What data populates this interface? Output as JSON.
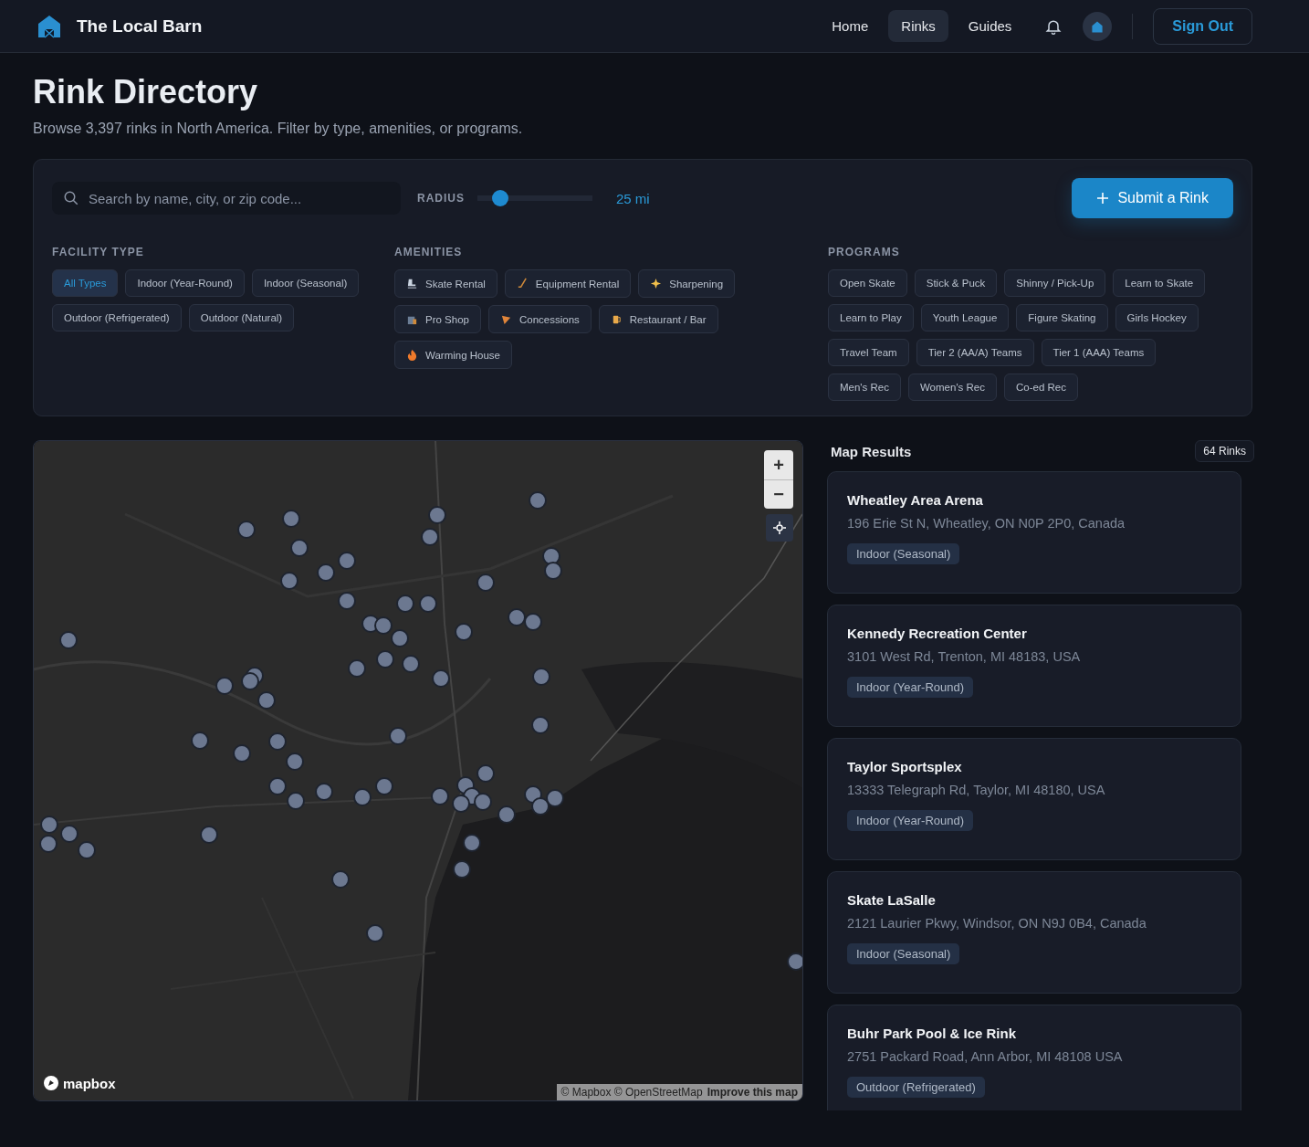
{
  "nav": {
    "brand": "The Local Barn",
    "links": [
      {
        "label": "Home",
        "selected": false
      },
      {
        "label": "Rinks",
        "selected": true
      },
      {
        "label": "Guides",
        "selected": false
      }
    ],
    "sign_out": "Sign Out"
  },
  "page": {
    "title": "Rink Directory",
    "subtitle": "Browse 3,397 rinks in North America. Filter by type, amenities, or programs."
  },
  "filters": {
    "search": {
      "placeholder": "Search by name, city, or zip code..."
    },
    "radius": {
      "label": "RADIUS",
      "level": 0.2,
      "reading": "25 mi"
    },
    "submit": "Submit a Rink",
    "facility_type": {
      "title": "FACILITY TYPE",
      "options": [
        {
          "label": "All Types",
          "selected": true
        },
        {
          "label": "Indoor (Year-Round)",
          "selected": false
        },
        {
          "label": "Indoor (Seasonal)",
          "selected": false
        },
        {
          "label": "Outdoor (Refrigerated)",
          "selected": false
        },
        {
          "label": "Outdoor (Natural)",
          "selected": false
        }
      ]
    },
    "amenities": {
      "title": "AMENITIES",
      "options": [
        {
          "label": "Skate Rental",
          "selected": false
        },
        {
          "label": "Equipment Rental",
          "selected": false
        },
        {
          "label": "Sharpening",
          "selected": false
        },
        {
          "label": "Pro Shop",
          "selected": false
        },
        {
          "label": "Concessions",
          "selected": false
        },
        {
          "label": "Restaurant / Bar",
          "selected": false
        },
        {
          "label": "Warming House",
          "selected": false
        }
      ]
    },
    "programs": {
      "title": "PROGRAMS",
      "options": [
        {
          "label": "Open Skate",
          "selected": false
        },
        {
          "label": "Stick & Puck",
          "selected": false
        },
        {
          "label": "Shinny / Pick-Up",
          "selected": false
        },
        {
          "label": "Learn to Skate",
          "selected": false
        },
        {
          "label": "Learn to Play",
          "selected": false
        },
        {
          "label": "Youth League",
          "selected": false
        },
        {
          "label": "Figure Skating",
          "selected": false
        },
        {
          "label": "Girls Hockey",
          "selected": false
        },
        {
          "label": "Travel Team",
          "selected": false
        },
        {
          "label": "Tier 2 (AA/A) Teams",
          "selected": false
        },
        {
          "label": "Tier 1 (AAA) Teams",
          "selected": false
        },
        {
          "label": "Men's Rec",
          "selected": false
        },
        {
          "label": "Women's Rec",
          "selected": false
        },
        {
          "label": "Co-ed Rec",
          "selected": false
        }
      ]
    }
  },
  "map": {
    "kind": "picture",
    "zoom_in": "+",
    "zoom_out": "−",
    "logo": "mapbox",
    "attribution": "© Mapbox © OpenStreetMap",
    "improve": "Improve this map"
  },
  "results": {
    "title": "Map Results",
    "count": "64 Rinks",
    "rinks": [
      {
        "name": "Wheatley Area Arena",
        "address": "196 Erie St N, Wheatley, ON N0P 2P0, Canada",
        "type": "Indoor (Seasonal)"
      },
      {
        "name": "Kennedy Recreation Center",
        "address": "3101 West Rd, Trenton, MI 48183, USA",
        "type": "Indoor (Year-Round)"
      },
      {
        "name": "Taylor Sportsplex",
        "address": "13333 Telegraph Rd, Taylor, MI 48180, USA",
        "type": "Indoor (Year-Round)"
      },
      {
        "name": "Skate LaSalle",
        "address": "2121 Laurier Pkwy, Windsor, ON N9J 0B4, Canada",
        "type": "Indoor (Seasonal)"
      },
      {
        "name": "Buhr Park Pool & Ice Rink",
        "address": "2751 Packard Road, Ann Arbor, MI 48108 USA",
        "type": "Outdoor (Refrigerated)"
      }
    ]
  }
}
